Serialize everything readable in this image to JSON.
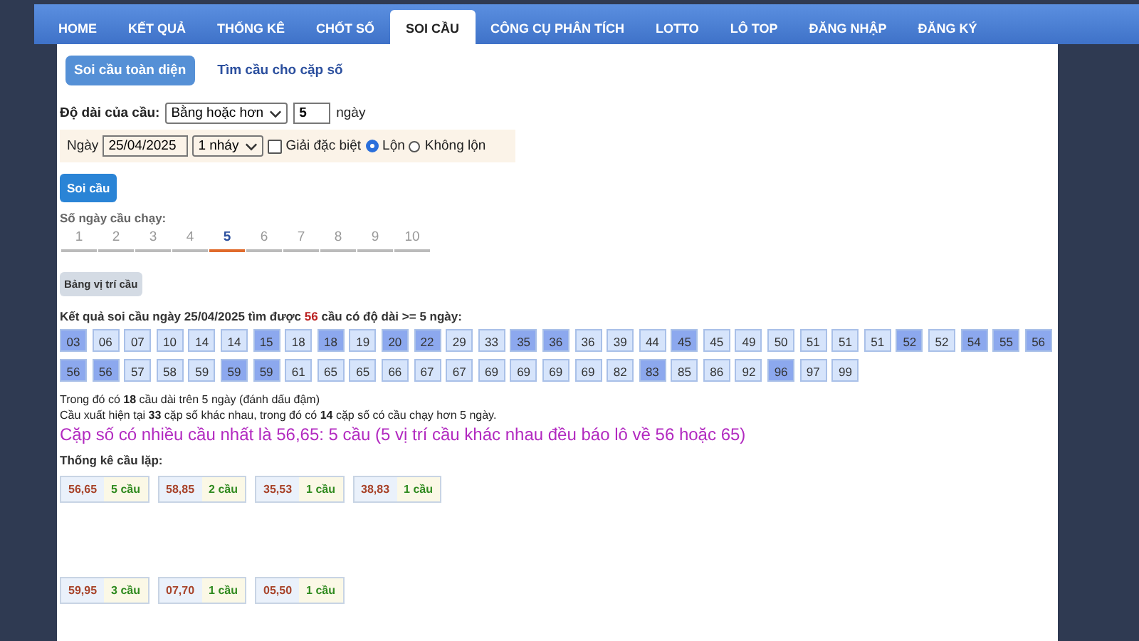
{
  "nav": [
    {
      "label": "HOME",
      "selected": false
    },
    {
      "label": "KẾT QUẢ",
      "selected": false
    },
    {
      "label": "THỐNG KÊ",
      "selected": false
    },
    {
      "label": "CHỐT SỐ",
      "selected": false
    },
    {
      "label": "SOI CẦU",
      "selected": true
    },
    {
      "label": "CÔNG CỤ PHÂN TÍCH",
      "selected": false
    },
    {
      "label": "LOTTO",
      "selected": false
    },
    {
      "label": "LÔ TOP",
      "selected": false
    },
    {
      "label": "ĐĂNG NHẬP",
      "selected": false
    },
    {
      "label": "ĐĂNG KÝ",
      "selected": false
    }
  ],
  "subtabs": [
    {
      "label": "Soi cầu toàn diện",
      "selected": true
    },
    {
      "label": "Tìm cầu cho cặp số",
      "selected": false
    }
  ],
  "length_row": {
    "label": "Độ dài của cầu:",
    "select": "Bằng hoặc hơn",
    "value": "5",
    "unit": "ngày"
  },
  "filter_row": {
    "date_label": "Ngày",
    "date": "25/04/2025",
    "step_select": "1 nháy",
    "special": {
      "label": "Giải đặc biệt",
      "checked": false
    },
    "radios": [
      {
        "label": "Lộn",
        "selected": true
      },
      {
        "label": "Không lộn",
        "selected": false
      }
    ]
  },
  "submit_button": "Soi cầu",
  "days_label": "Số ngày cầu chạy:",
  "days": [
    {
      "label": "1",
      "selected": false
    },
    {
      "label": "2",
      "selected": false
    },
    {
      "label": "3",
      "selected": false
    },
    {
      "label": "4",
      "selected": false
    },
    {
      "label": "5",
      "selected": true
    },
    {
      "label": "6",
      "selected": false
    },
    {
      "label": "7",
      "selected": false
    },
    {
      "label": "8",
      "selected": false
    },
    {
      "label": "9",
      "selected": false
    },
    {
      "label": "10",
      "selected": false
    }
  ],
  "position_button": "Bảng vị trí cầu",
  "result_heading": "Kết quả soi cầu ngày 25/04/2025 tìm được **56** cầu có độ dài >= 5 ngày:",
  "numbers": [
    {
      "n": "03",
      "highlighted": true
    },
    {
      "n": "06",
      "highlighted": false
    },
    {
      "n": "07",
      "highlighted": false
    },
    {
      "n": "10",
      "highlighted": false
    },
    {
      "n": "14",
      "highlighted": false
    },
    {
      "n": "14",
      "highlighted": false
    },
    {
      "n": "15",
      "highlighted": true
    },
    {
      "n": "18",
      "highlighted": false
    },
    {
      "n": "18",
      "highlighted": true
    },
    {
      "n": "19",
      "highlighted": false
    },
    {
      "n": "20",
      "highlighted": true
    },
    {
      "n": "22",
      "highlighted": true
    },
    {
      "n": "29",
      "highlighted": false
    },
    {
      "n": "33",
      "highlighted": false
    },
    {
      "n": "35",
      "highlighted": true
    },
    {
      "n": "36",
      "highlighted": true
    },
    {
      "n": "36",
      "highlighted": false
    },
    {
      "n": "39",
      "highlighted": false
    },
    {
      "n": "44",
      "highlighted": false
    },
    {
      "n": "45",
      "highlighted": true
    },
    {
      "n": "45",
      "highlighted": false
    },
    {
      "n": "49",
      "highlighted": false
    },
    {
      "n": "50",
      "highlighted": false
    },
    {
      "n": "51",
      "highlighted": false
    },
    {
      "n": "51",
      "highlighted": false
    },
    {
      "n": "51",
      "highlighted": false
    },
    {
      "n": "52",
      "highlighted": true
    },
    {
      "n": "52",
      "highlighted": false
    },
    {
      "n": "54",
      "highlighted": true
    },
    {
      "n": "55",
      "highlighted": true
    },
    {
      "n": "56",
      "highlighted": true
    },
    {
      "n": "56",
      "highlighted": true
    },
    {
      "n": "56",
      "highlighted": true
    },
    {
      "n": "57",
      "highlighted": false
    },
    {
      "n": "58",
      "highlighted": false
    },
    {
      "n": "59",
      "highlighted": false
    },
    {
      "n": "59",
      "highlighted": true
    },
    {
      "n": "59",
      "highlighted": true
    },
    {
      "n": "61",
      "highlighted": false
    },
    {
      "n": "65",
      "highlighted": false
    },
    {
      "n": "65",
      "highlighted": false
    },
    {
      "n": "66",
      "highlighted": false
    },
    {
      "n": "67",
      "highlighted": false
    },
    {
      "n": "67",
      "highlighted": false
    },
    {
      "n": "69",
      "highlighted": false
    },
    {
      "n": "69",
      "highlighted": false
    },
    {
      "n": "69",
      "highlighted": false
    },
    {
      "n": "69",
      "highlighted": false
    },
    {
      "n": "82",
      "highlighted": false
    },
    {
      "n": "83",
      "highlighted": true
    },
    {
      "n": "85",
      "highlighted": false
    },
    {
      "n": "86",
      "highlighted": false
    },
    {
      "n": "92",
      "highlighted": false
    },
    {
      "n": "96",
      "highlighted": true
    },
    {
      "n": "97",
      "highlighted": false
    },
    {
      "n": "99",
      "highlighted": false
    }
  ],
  "summary": [
    "Trong đó có **18** cầu dài trên 5 ngày (đánh dấu đậm)",
    "Cầu xuất hiện tại **33** cặp số khác nhau, trong đó có **14** cặp số có cầu chạy hơn 5 ngày."
  ],
  "highlight_text": "Cặp số có nhiều cầu nhất là 56,65: 5 cầu (5 vị trí cầu khác nhau đều báo lô về 56 hoặc 65)",
  "repeat_heading": "Thống kê cầu lặp:",
  "pair_rows": [
    [
      {
        "pair": "56,65",
        "count": "5 cầu"
      },
      {
        "pair": "58,85",
        "count": "2 cầu"
      },
      {
        "pair": "35,53",
        "count": "1 cầu"
      },
      {
        "pair": "38,83",
        "count": "1 cầu"
      }
    ],
    [
      {
        "pair": "59,95",
        "count": "3 cầu"
      },
      {
        "pair": "07,70",
        "count": "1 cầu"
      },
      {
        "pair": "05,50",
        "count": "1 cầu"
      }
    ]
  ]
}
